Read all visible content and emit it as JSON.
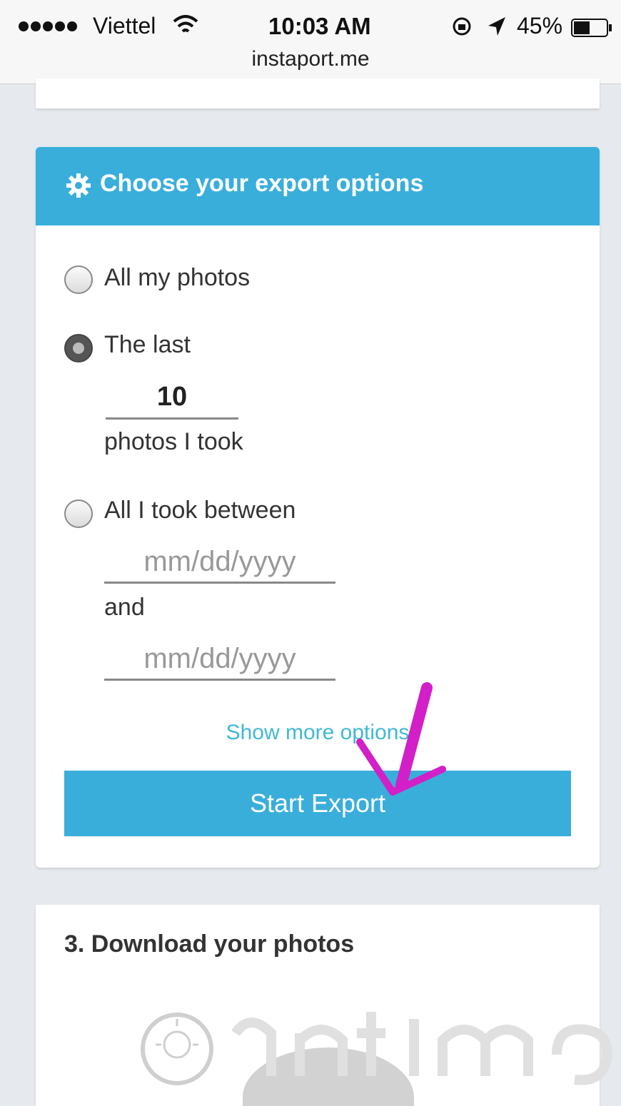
{
  "status_bar": {
    "carrier": "Viettel",
    "time": "10:03 AM",
    "battery": "45%"
  },
  "browser": {
    "url": "instaport.me"
  },
  "export_card": {
    "title": "Choose your export options",
    "options": [
      {
        "label": "All my photos",
        "checked": false
      },
      {
        "label": "The last",
        "checked": true
      },
      {
        "label": "All I took between",
        "checked": false
      }
    ],
    "last_count_value": "10",
    "last_count_suffix": "photos I took",
    "date_from_placeholder": "mm/dd/yyyy",
    "date_join": "and",
    "date_to_placeholder": "mm/dd/yyyy",
    "more_options_link": "Show more options",
    "start_button": "Start Export"
  },
  "download_card": {
    "title": "3. Download your photos"
  },
  "colors": {
    "accent": "#39aedb",
    "link": "#3fb9d6",
    "annotation_arrow": "#d21fc8"
  }
}
